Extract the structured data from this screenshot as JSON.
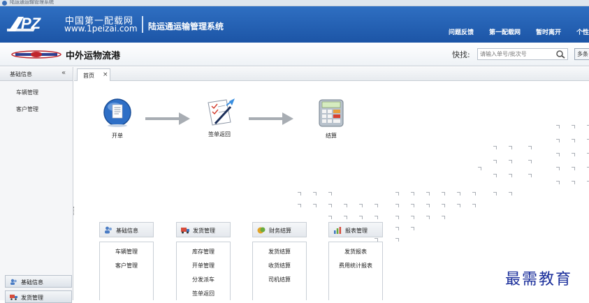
{
  "window": {
    "title": "陆运通运输管理系统"
  },
  "banner": {
    "logo_cn": "中国第一配载网",
    "logo_url": "www.1peizai.com",
    "system_title": "陆运通运输管理系统",
    "links": [
      "问题反馈",
      "第一配载网",
      "暂时离开",
      "个性"
    ]
  },
  "subheader": {
    "company_name": "中外运物流港",
    "quick_label": "快找:",
    "quick_placeholder": "请输入单号/批次号",
    "more_button": "多条"
  },
  "sidebar": {
    "header": "基础信息",
    "collapse": "«",
    "items": [
      "车辆管理",
      "客户管理"
    ],
    "footer": [
      "基础信息",
      "发货管理"
    ]
  },
  "tabs": [
    {
      "label": "首页",
      "close": "×"
    }
  ],
  "flow": [
    {
      "label": "开单",
      "icon": "document-globe-icon"
    },
    {
      "label": "签单返回",
      "icon": "sign-document-icon"
    },
    {
      "label": "结算",
      "icon": "calculator-icon"
    }
  ],
  "modules": [
    {
      "title": "基础信息",
      "icon": "users-icon",
      "items": [
        "车辆管理",
        "客户管理"
      ]
    },
    {
      "title": "发货管理",
      "icon": "truck-icon",
      "items": [
        "库存管理",
        "开单管理",
        "分发派车",
        "签单返回"
      ]
    },
    {
      "title": "财务结算",
      "icon": "money-icon",
      "items": [
        "发货结算",
        "收货结算",
        "司机结算"
      ]
    },
    {
      "title": "报表管理",
      "icon": "chart-icon",
      "items": [
        "发货报表",
        "费用统计报表"
      ]
    }
  ],
  "watermark": "最需教育",
  "colors": {
    "banner": "#1f5eae",
    "accent": "#2f6fc2",
    "watermark": "#1b2f9b"
  }
}
